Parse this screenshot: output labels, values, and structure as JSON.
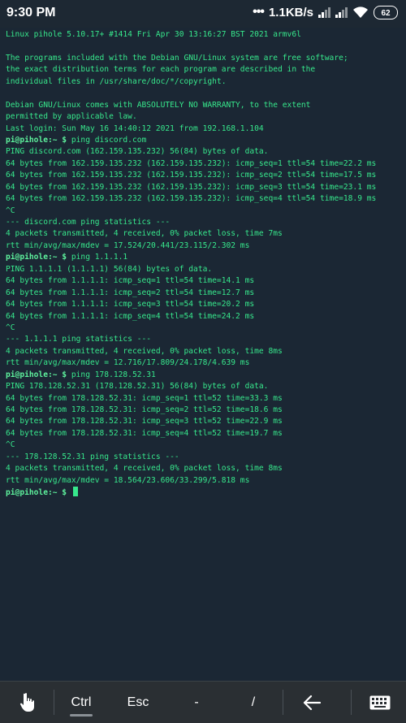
{
  "status_bar": {
    "time": "9:30 PM",
    "dots": "•••",
    "network_speed": "1.1KB/s",
    "battery": "62"
  },
  "terminal": {
    "lines": [
      {
        "text": "Linux pihole 5.10.17+ #1414 Fri Apr 30 13:16:27 BST 2021 armv6l"
      },
      {
        "text": ""
      },
      {
        "text": "The programs included with the Debian GNU/Linux system are free software;"
      },
      {
        "text": "the exact distribution terms for each program are described in the"
      },
      {
        "text": "individual files in /usr/share/doc/*/copyright."
      },
      {
        "text": ""
      },
      {
        "text": "Debian GNU/Linux comes with ABSOLUTELY NO WARRANTY, to the extent"
      },
      {
        "text": "permitted by applicable law."
      },
      {
        "text": "Last login: Sun May 16 14:40:12 2021 from 192.168.1.104"
      },
      {
        "prompt": "pi@pihole:~ $",
        "cmd": " ping discord.com"
      },
      {
        "text": "PING discord.com (162.159.135.232) 56(84) bytes of data."
      },
      {
        "text": "64 bytes from 162.159.135.232 (162.159.135.232): icmp_seq=1 ttl=54 time=22.2 ms"
      },
      {
        "text": "64 bytes from 162.159.135.232 (162.159.135.232): icmp_seq=2 ttl=54 time=17.5 ms"
      },
      {
        "text": "64 bytes from 162.159.135.232 (162.159.135.232): icmp_seq=3 ttl=54 time=23.1 ms"
      },
      {
        "text": "64 bytes from 162.159.135.232 (162.159.135.232): icmp_seq=4 ttl=54 time=18.9 ms"
      },
      {
        "text": "^C"
      },
      {
        "text": "--- discord.com ping statistics ---"
      },
      {
        "text": "4 packets transmitted, 4 received, 0% packet loss, time 7ms"
      },
      {
        "text": "rtt min/avg/max/mdev = 17.524/20.441/23.115/2.302 ms"
      },
      {
        "prompt": "pi@pihole:~ $",
        "cmd": " ping 1.1.1.1"
      },
      {
        "text": "PING 1.1.1.1 (1.1.1.1) 56(84) bytes of data."
      },
      {
        "text": "64 bytes from 1.1.1.1: icmp_seq=1 ttl=54 time=14.1 ms"
      },
      {
        "text": "64 bytes from 1.1.1.1: icmp_seq=2 ttl=54 time=12.7 ms"
      },
      {
        "text": "64 bytes from 1.1.1.1: icmp_seq=3 ttl=54 time=20.2 ms"
      },
      {
        "text": "64 bytes from 1.1.1.1: icmp_seq=4 ttl=54 time=24.2 ms"
      },
      {
        "text": "^C"
      },
      {
        "text": "--- 1.1.1.1 ping statistics ---"
      },
      {
        "text": "4 packets transmitted, 4 received, 0% packet loss, time 8ms"
      },
      {
        "text": "rtt min/avg/max/mdev = 12.716/17.809/24.178/4.639 ms"
      },
      {
        "prompt": "pi@pihole:~ $",
        "cmd": " ping 178.128.52.31"
      },
      {
        "text": "PING 178.128.52.31 (178.128.52.31) 56(84) bytes of data."
      },
      {
        "text": "64 bytes from 178.128.52.31: icmp_seq=1 ttl=52 time=33.3 ms"
      },
      {
        "text": "64 bytes from 178.128.52.31: icmp_seq=2 ttl=52 time=18.6 ms"
      },
      {
        "text": "64 bytes from 178.128.52.31: icmp_seq=3 ttl=52 time=22.9 ms"
      },
      {
        "text": "64 bytes from 178.128.52.31: icmp_seq=4 ttl=52 time=19.7 ms"
      },
      {
        "text": "^C"
      },
      {
        "text": "--- 178.128.52.31 ping statistics ---"
      },
      {
        "text": "4 packets transmitted, 4 received, 0% packet loss, time 8ms"
      },
      {
        "text": "rtt min/avg/max/mdev = 18.564/23.606/33.299/5.818 ms"
      },
      {
        "prompt": "pi@pihole:~ $",
        "cmd": " ",
        "cursor": true
      }
    ]
  },
  "extra_keys": {
    "touch_icon": "hand-pointer-icon",
    "ctrl": "Ctrl",
    "esc": "Esc",
    "dash": "-",
    "slash": "/",
    "back_icon": "arrow-left-icon",
    "keyboard_icon": "keyboard-icon"
  },
  "colors": {
    "background": "#1b2734",
    "terminal_text": "#37e88c",
    "toolbar": "#2a2f33"
  }
}
